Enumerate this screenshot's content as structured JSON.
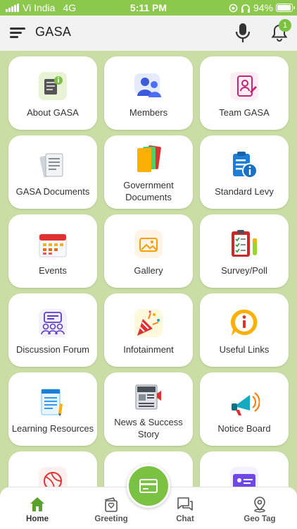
{
  "status_bar": {
    "carrier": "Vi India",
    "network": "4G",
    "time": "5:11 PM",
    "battery": "94%",
    "battery_level": 0.94
  },
  "app_bar": {
    "title": "GASA",
    "notification_count": "1",
    "accent_color": "#7cc242"
  },
  "tiles": [
    {
      "label": "About GASA",
      "icon": "about-doc-icon"
    },
    {
      "label": "Members",
      "icon": "members-icon"
    },
    {
      "label": "Team GASA",
      "icon": "team-id-icon"
    },
    {
      "label": "GASA Documents",
      "icon": "documents-stack-icon"
    },
    {
      "label": "Government Documents",
      "icon": "folders-icon"
    },
    {
      "label": "Standard Levy",
      "icon": "clipboard-info-icon"
    },
    {
      "label": "Events",
      "icon": "calendar-icon"
    },
    {
      "label": "Gallery",
      "icon": "gallery-icon"
    },
    {
      "label": "Survey/Poll",
      "icon": "checklist-icon"
    },
    {
      "label": "Discussion Forum",
      "icon": "forum-icon"
    },
    {
      "label": "Infotainment",
      "icon": "party-popper-icon"
    },
    {
      "label": "Useful Links",
      "icon": "info-circle-icon"
    },
    {
      "label": "Learning Resources",
      "icon": "notepad-pencil-icon"
    },
    {
      "label": "News & Success Story",
      "icon": "newspaper-icon"
    },
    {
      "label": "Notice Board",
      "icon": "megaphone-icon"
    }
  ],
  "bottom_nav": {
    "items": [
      {
        "label": "Home",
        "icon": "home-icon",
        "active": true
      },
      {
        "label": "Greeting",
        "icon": "greeting-card-icon"
      },
      {
        "label": "Chat",
        "icon": "chat-icon"
      },
      {
        "label": "Geo Tag",
        "icon": "location-pin-icon"
      }
    ],
    "fab_icon": "card-icon"
  }
}
